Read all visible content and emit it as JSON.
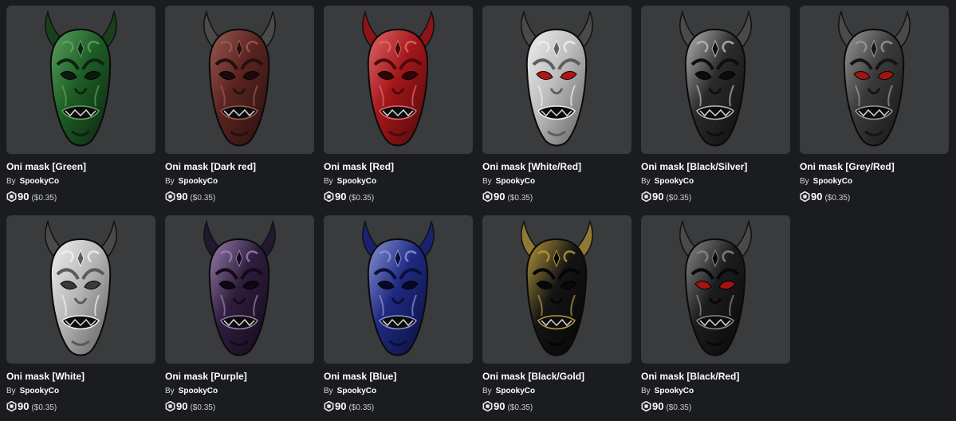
{
  "items": [
    {
      "name": "Oni mask [Green]",
      "by": "By",
      "creator": "SpookyCo",
      "price": "90",
      "usd": "($0.35)",
      "colors": {
        "base": "#1f5d26",
        "dark": "#0b2410",
        "light": "#5aa35f",
        "horn": "#1a3f1d",
        "eye": "#0d1a0e"
      }
    },
    {
      "name": "Oni mask [Dark red]",
      "by": "By",
      "creator": "SpookyCo",
      "price": "90",
      "usd": "($0.35)",
      "colors": {
        "base": "#5a2320",
        "dark": "#25100e",
        "light": "#9a5a52",
        "horn": "#4a4a4a",
        "eye": "#1a0b0a"
      }
    },
    {
      "name": "Oni mask [Red]",
      "by": "By",
      "creator": "SpookyCo",
      "price": "90",
      "usd": "($0.35)",
      "colors": {
        "base": "#a3161a",
        "dark": "#4a0a0c",
        "light": "#e06a6a",
        "horn": "#8a1418",
        "eye": "#300506"
      }
    },
    {
      "name": "Oni mask [White/Red]",
      "by": "By",
      "creator": "SpookyCo",
      "price": "90",
      "usd": "($0.35)",
      "colors": {
        "base": "#bdbdbd",
        "dark": "#5e5e5e",
        "light": "#f0f0f0",
        "horn": "#4a4a4a",
        "eye": "#b01515"
      }
    },
    {
      "name": "Oni mask [Black/Silver]",
      "by": "By",
      "creator": "SpookyCo",
      "price": "90",
      "usd": "($0.35)",
      "colors": {
        "base": "#2a2a2a",
        "dark": "#0e0e0e",
        "light": "#b9b9b9",
        "horn": "#4a4a4a",
        "eye": "#0c0c0c"
      }
    },
    {
      "name": "Oni mask [Grey/Red]",
      "by": "By",
      "creator": "SpookyCo",
      "price": "90",
      "usd": "($0.35)",
      "colors": {
        "base": "#3a3a3a",
        "dark": "#151515",
        "light": "#9a9a9a",
        "horn": "#4a4a4a",
        "eye": "#a31414"
      }
    },
    {
      "name": "Oni mask [White]",
      "by": "By",
      "creator": "SpookyCo",
      "price": "90",
      "usd": "($0.35)",
      "colors": {
        "base": "#b8b8b8",
        "dark": "#5a5a5a",
        "light": "#f2f2f2",
        "horn": "#4a4a4a",
        "eye": "#3a3a3a"
      }
    },
    {
      "name": "Oni mask [Purple]",
      "by": "By",
      "creator": "SpookyCo",
      "price": "90",
      "usd": "($0.35)",
      "colors": {
        "base": "#2e1d3c",
        "dark": "#120b18",
        "light": "#9a7fb0",
        "horn": "#221830",
        "eye": "#0d0812"
      }
    },
    {
      "name": "Oni mask [Blue]",
      "by": "By",
      "creator": "SpookyCo",
      "price": "90",
      "usd": "($0.35)",
      "colors": {
        "base": "#1f2a80",
        "dark": "#0a0f38",
        "light": "#8a94d8",
        "horn": "#1a2270",
        "eye": "#070a26"
      }
    },
    {
      "name": "Oni mask [Black/Gold]",
      "by": "By",
      "creator": "SpookyCo",
      "price": "90",
      "usd": "($0.35)",
      "colors": {
        "base": "#141414",
        "dark": "#050505",
        "light": "#b89a3a",
        "horn": "#8f7a32",
        "eye": "#080808"
      }
    },
    {
      "name": "Oni mask [Black/Red]",
      "by": "By",
      "creator": "SpookyCo",
      "price": "90",
      "usd": "($0.35)",
      "colors": {
        "base": "#1c1c1c",
        "dark": "#080808",
        "light": "#8a8a8a",
        "horn": "#4a4a4a",
        "eye": "#a31414"
      }
    }
  ]
}
